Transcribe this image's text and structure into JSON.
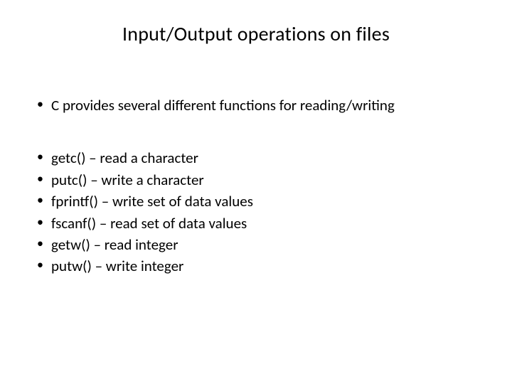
{
  "title": "Input/Output operations on files",
  "intro": "C provides several different functions for reading/writing",
  "functions": [
    "getc() – read a character",
    "putc() – write a character",
    "fprintf() – write set of data values",
    "fscanf() – read set of data values",
    "getw() – read integer",
    "putw() – write integer"
  ]
}
